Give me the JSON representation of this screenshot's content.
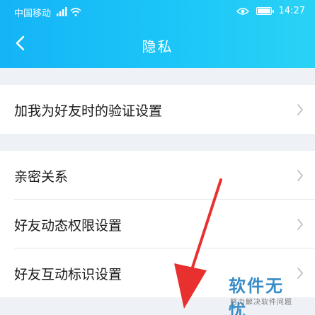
{
  "status_bar": {
    "carrier": "中国移动",
    "time": "14:27",
    "icons": [
      "signal-icon",
      "wifi-icon",
      "eye-icon",
      "battery-icon"
    ]
  },
  "nav": {
    "title": "隐私",
    "back_icon": "chevron-left-icon"
  },
  "sections": [
    {
      "items": [
        {
          "label": "加我为好友时的验证设置",
          "chevron": true
        }
      ]
    },
    {
      "items": [
        {
          "label": "亲密关系",
          "chevron": true
        },
        {
          "label": "好友动态权限设置",
          "chevron": true
        },
        {
          "label": "好友互动标识设置",
          "chevron": true
        }
      ]
    }
  ],
  "watermark": {
    "title": "软件无忧",
    "subtitle": "努力解决软件问题"
  },
  "colors": {
    "header_start": "#14b4f6",
    "header_end": "#2ad2f5",
    "background": "#eef1f5",
    "arrow": "#e8312f",
    "watermark": "#3a8cc7"
  }
}
